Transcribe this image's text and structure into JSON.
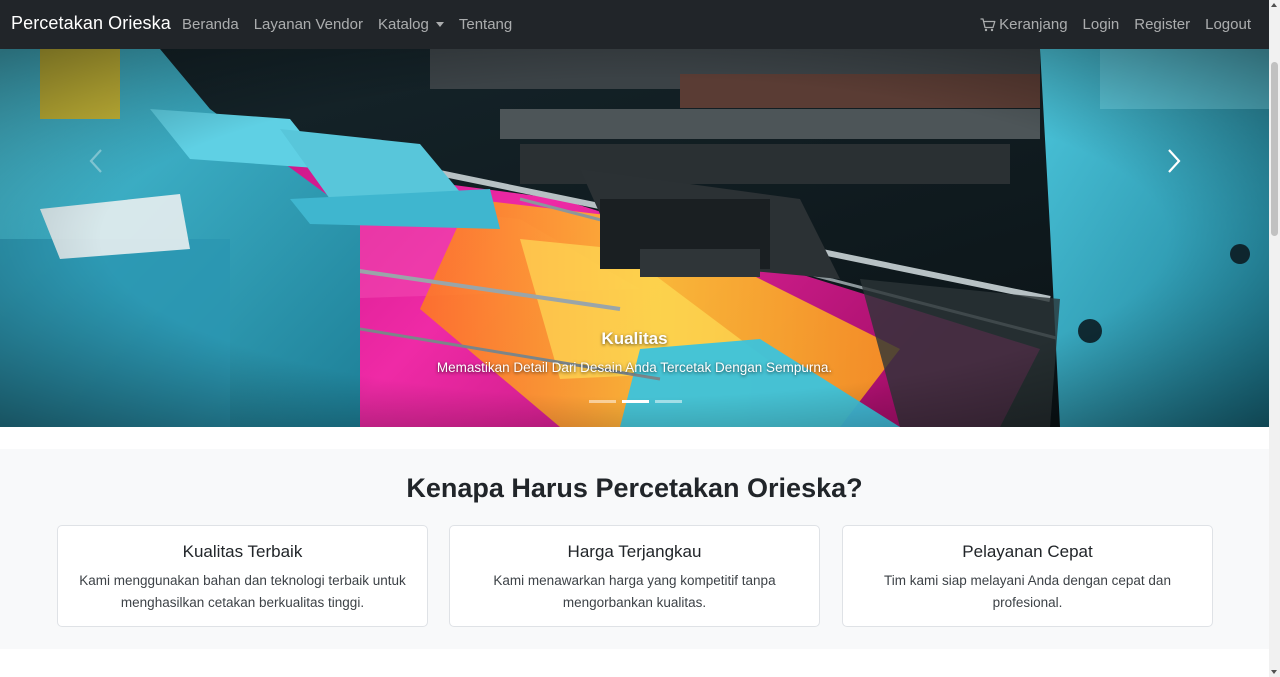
{
  "navbar": {
    "brand": "Percetakan Orieska",
    "left_links": [
      {
        "label": "Beranda"
      },
      {
        "label": "Layanan Vendor"
      },
      {
        "label": "Katalog"
      },
      {
        "label": "Tentang"
      }
    ],
    "right_links": {
      "cart": "Keranjang",
      "login": "Login",
      "register": "Register",
      "logout": "Logout"
    },
    "icons": {
      "cart": "cart-icon",
      "dropdown": "chevron-down-icon"
    }
  },
  "hero": {
    "image": "printing-press-photo",
    "caption_title": "Kualitas",
    "caption_text": "Memastikan Detail Dari Desain Anda Tercetak Dengan Sempurna.",
    "slide_count": 3,
    "active_slide": 2,
    "icons": {
      "prev": "chevron-left-icon",
      "next": "chevron-right-icon"
    }
  },
  "why": {
    "title": "Kenapa Harus Percetakan Orieska?",
    "cards": [
      {
        "title": "Kualitas Terbaik",
        "text": "Kami menggunakan bahan dan teknologi terbaik untuk menghasilkan cetakan berkualitas tinggi."
      },
      {
        "title": "Harga Terjangkau",
        "text": "Kami menawarkan harga yang kompetitif tanpa mengorbankan kualitas."
      },
      {
        "title": "Pelayanan Cepat",
        "text": "Tim kami siap melayani Anda dengan cepat dan profesional."
      }
    ]
  },
  "colors": {
    "navbar_bg": "#212529",
    "section_bg": "#f8f9fa",
    "machine_teal": "#2aa7c2",
    "ink_magenta": "#e4169b",
    "ink_yellow": "#ffcf2a"
  }
}
